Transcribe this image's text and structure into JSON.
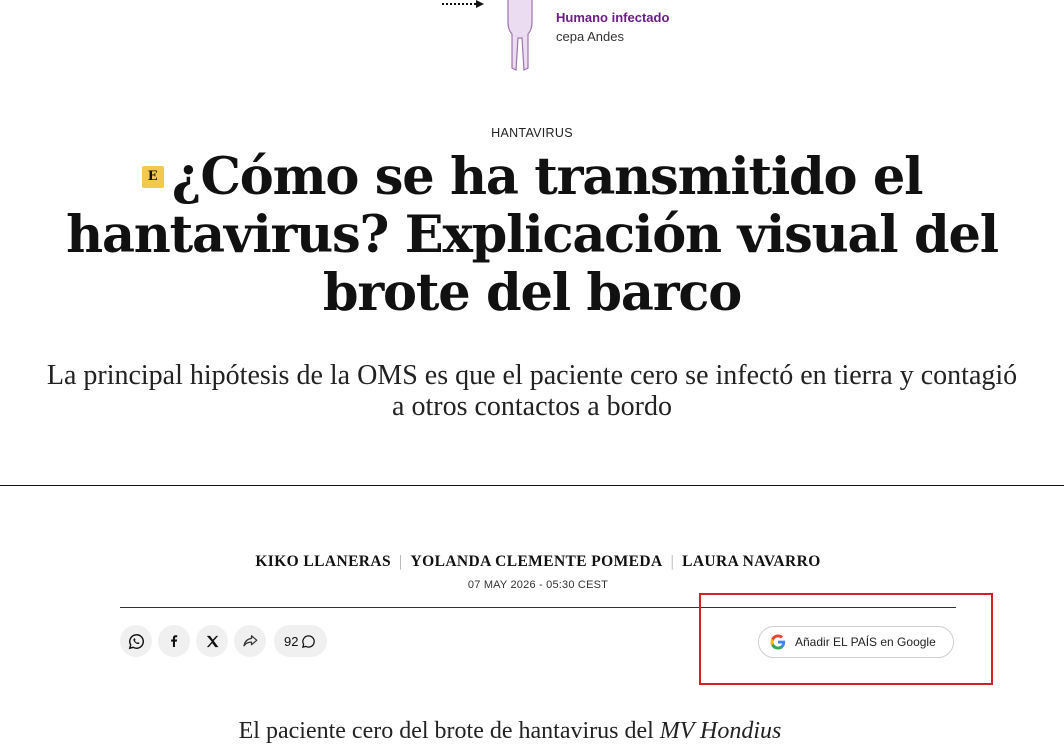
{
  "illustration": {
    "caption_bold": "Humano infectado",
    "caption_rest": " cepa Andes"
  },
  "article": {
    "kicker": "HANTAVIRUS",
    "badge": "E",
    "headline": "¿Cómo se ha transmitido el hantavirus? Explicación visual del brote del barco",
    "subhead": "La principal hipótesis de la OMS es que el paciente cero se infectó en tierra y contagió a otros contactos a bordo",
    "authors": [
      "KIKO LLANERAS",
      "YOLANDA CLEMENTE POMEDA",
      "LAURA NAVARRO"
    ],
    "date": "07 MAY 2026 - 05:30 CEST",
    "body_start": "El paciente cero del brote de hantavirus del ",
    "body_ship": "MV Hondius"
  },
  "share": {
    "icons": [
      "whatsapp-icon",
      "facebook-icon",
      "x-icon",
      "share-arrow-icon"
    ],
    "comments_count": "92"
  },
  "google_button": {
    "label": "Añadir EL PAÍS en Google"
  },
  "colors": {
    "accent_purple": "#6c1d86",
    "badge_yellow": "#f2c94c",
    "highlight_red": "#d32027"
  }
}
